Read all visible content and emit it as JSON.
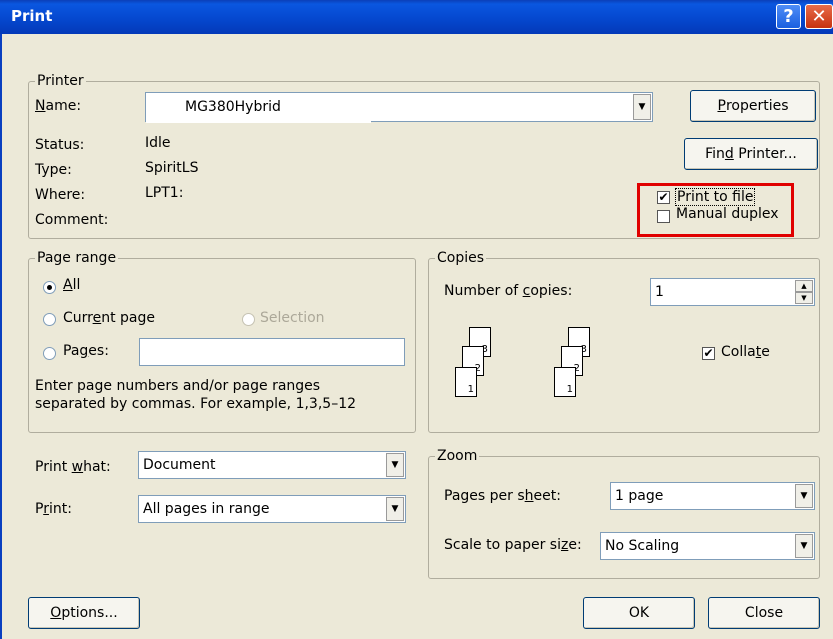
{
  "window": {
    "title": "Print",
    "help_icon": "?",
    "close_icon": "✕"
  },
  "printer": {
    "group_label": "Printer",
    "name_label": "Name:",
    "name_value": "MG380Hybrid",
    "status_label": "Status:",
    "status_value": "Idle",
    "type_label": "Type:",
    "type_value": "SpiritLS",
    "where_label": "Where:",
    "where_value": "LPT1:",
    "comment_label": "Comment:",
    "properties_button": "Properties",
    "find_printer_button": "Find Printer...",
    "print_to_file_label": "Print to file",
    "print_to_file_checked": true,
    "manual_duplex_label": "Manual duplex",
    "manual_duplex_checked": false,
    "highlight_color": "#e00000"
  },
  "page_range": {
    "group_label": "Page range",
    "all_label": "All",
    "current_page_label": "Current page",
    "selection_label": "Selection",
    "pages_label": "Pages:",
    "pages_value": "",
    "selected": "All",
    "help_line1": "Enter page numbers and/or page ranges",
    "help_line2": "separated by commas.  For example, 1,3,5–12"
  },
  "copies": {
    "group_label": "Copies",
    "number_label": "Number of copies:",
    "number_value": "1",
    "collate_label": "Collate",
    "collate_checked": true,
    "page_numbers": [
      "1",
      "2",
      "3"
    ]
  },
  "print_what": {
    "label": "Print what:",
    "value": "Document"
  },
  "print": {
    "label": "Print:",
    "value": "All pages in range"
  },
  "zoom": {
    "group_label": "Zoom",
    "pages_per_sheet_label": "Pages per sheet:",
    "pages_per_sheet_value": "1 page",
    "scale_label": "Scale to paper size:",
    "scale_value": "No Scaling"
  },
  "buttons": {
    "options": "Options...",
    "ok": "OK",
    "close": "Close"
  }
}
